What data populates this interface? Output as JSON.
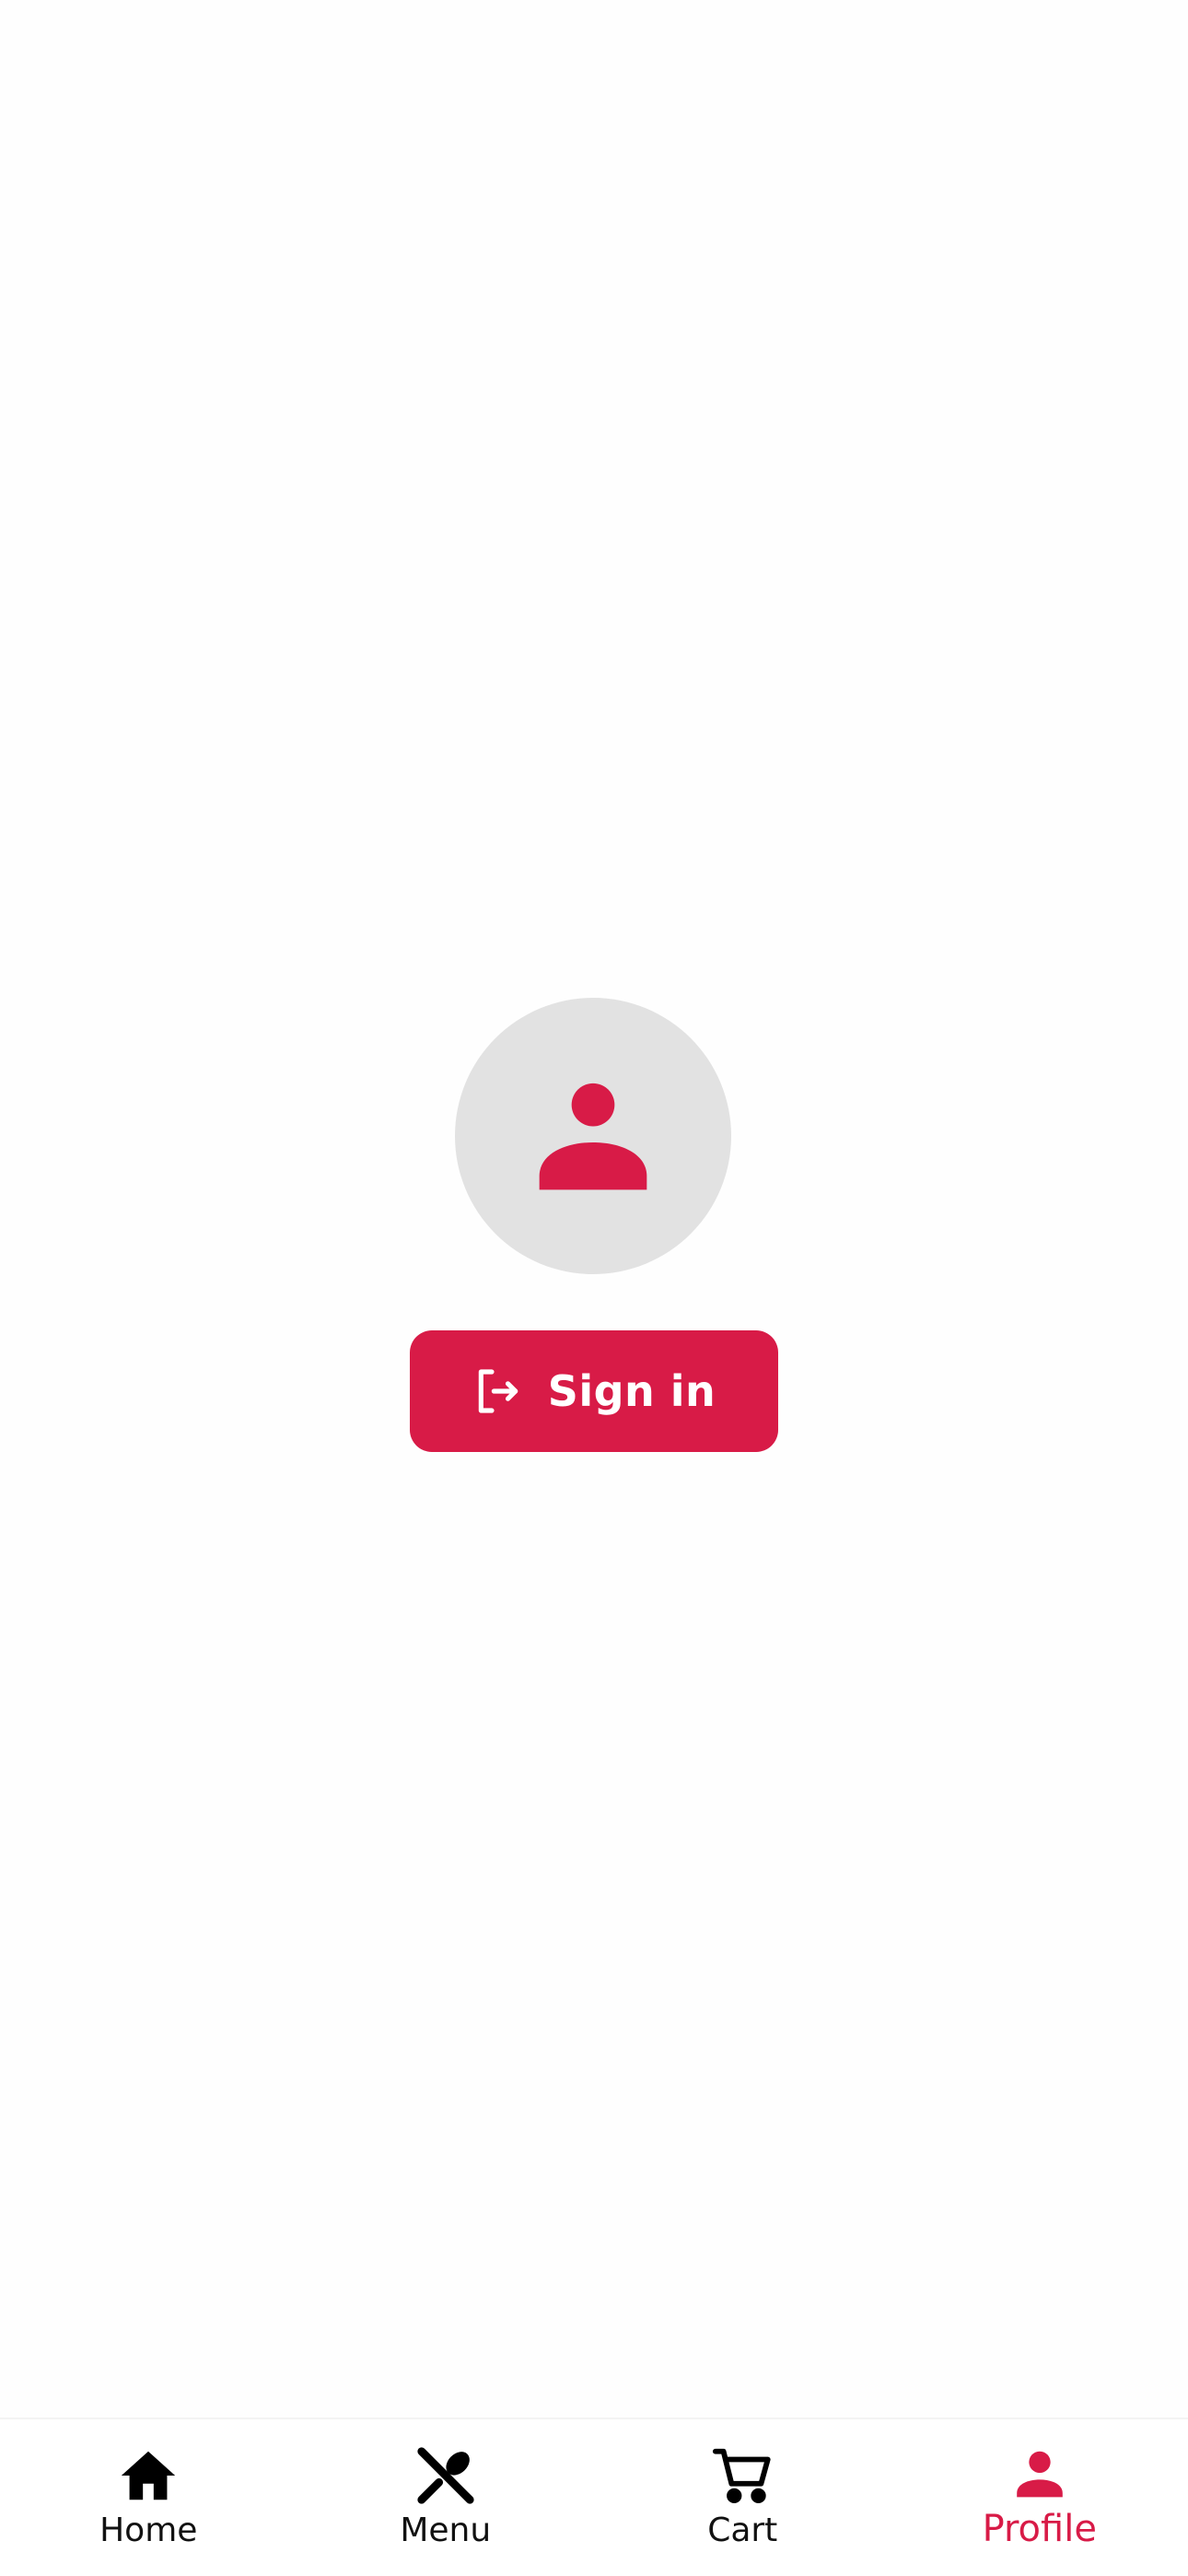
{
  "colors": {
    "accent": "#d81b47",
    "avatar_bg": "#e2e2e2",
    "background": "#fefefe",
    "nav_inactive": "#111111"
  },
  "profile": {
    "avatar_icon": "person-icon",
    "signin_icon": "login-icon",
    "signin_label": "Sign in"
  },
  "bottom_nav": {
    "active": "Profile",
    "items": [
      {
        "label": "Home",
        "icon": "home-icon"
      },
      {
        "label": "Menu",
        "icon": "utensils-icon"
      },
      {
        "label": "Cart",
        "icon": "cart-icon"
      },
      {
        "label": "Profile",
        "icon": "person-icon"
      }
    ]
  }
}
